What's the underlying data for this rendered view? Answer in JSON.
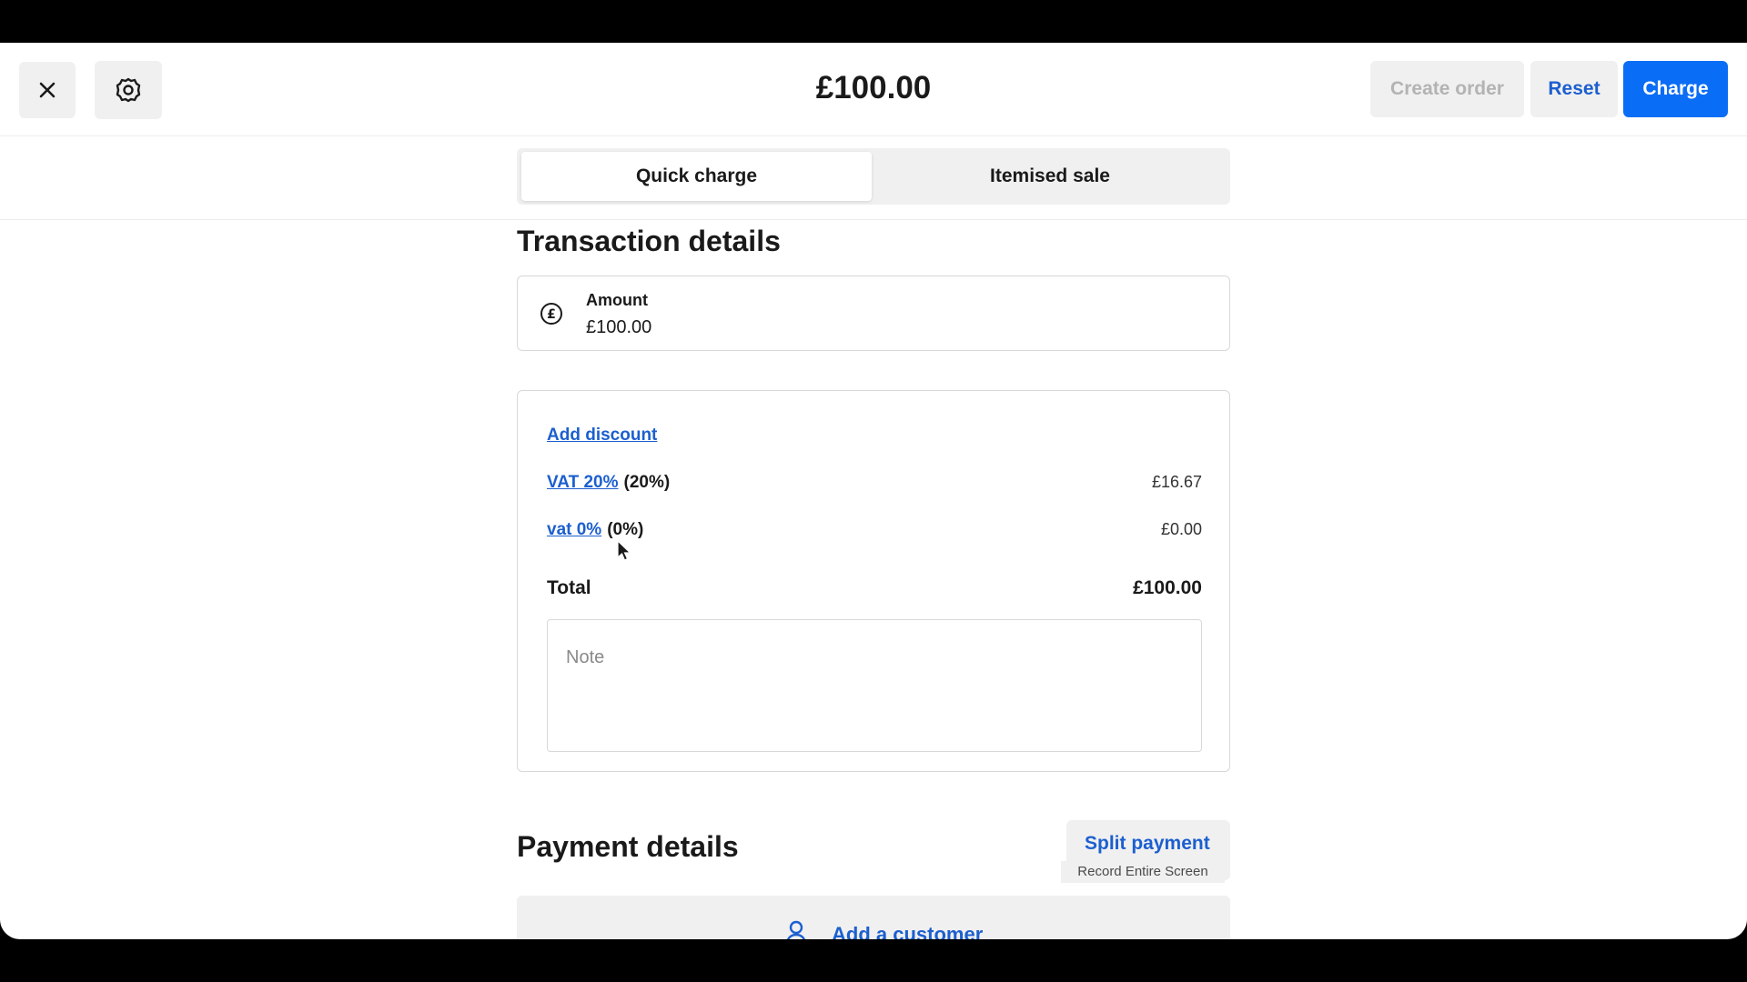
{
  "header": {
    "title": "£100.00",
    "close_icon": "close-icon",
    "settings_icon": "gear-icon",
    "create_order_label": "Create order",
    "reset_label": "Reset",
    "charge_label": "Charge"
  },
  "tabs": [
    {
      "label": "Quick charge",
      "active": true
    },
    {
      "label": "Itemised sale",
      "active": false
    }
  ],
  "transaction": {
    "heading": "Transaction details",
    "amount_label": "Amount",
    "amount_value": "£100.00",
    "add_discount_label": "Add discount",
    "taxes": [
      {
        "name": "VAT 20%",
        "rate": "(20%)",
        "amount": "£16.67"
      },
      {
        "name": "vat 0%",
        "rate": "(0%)",
        "amount": "£0.00"
      }
    ],
    "total_label": "Total",
    "total_value": "£100.00",
    "note_placeholder": "Note"
  },
  "payment": {
    "heading": "Payment details",
    "split_payment_label": "Split payment",
    "record_tooltip": "Record Entire Screen",
    "add_customer_label": "Add a customer"
  },
  "colors": {
    "accent_blue": "#1c5fcf",
    "charge_blue": "#0a6df5",
    "button_grey": "#f0f0f0"
  }
}
